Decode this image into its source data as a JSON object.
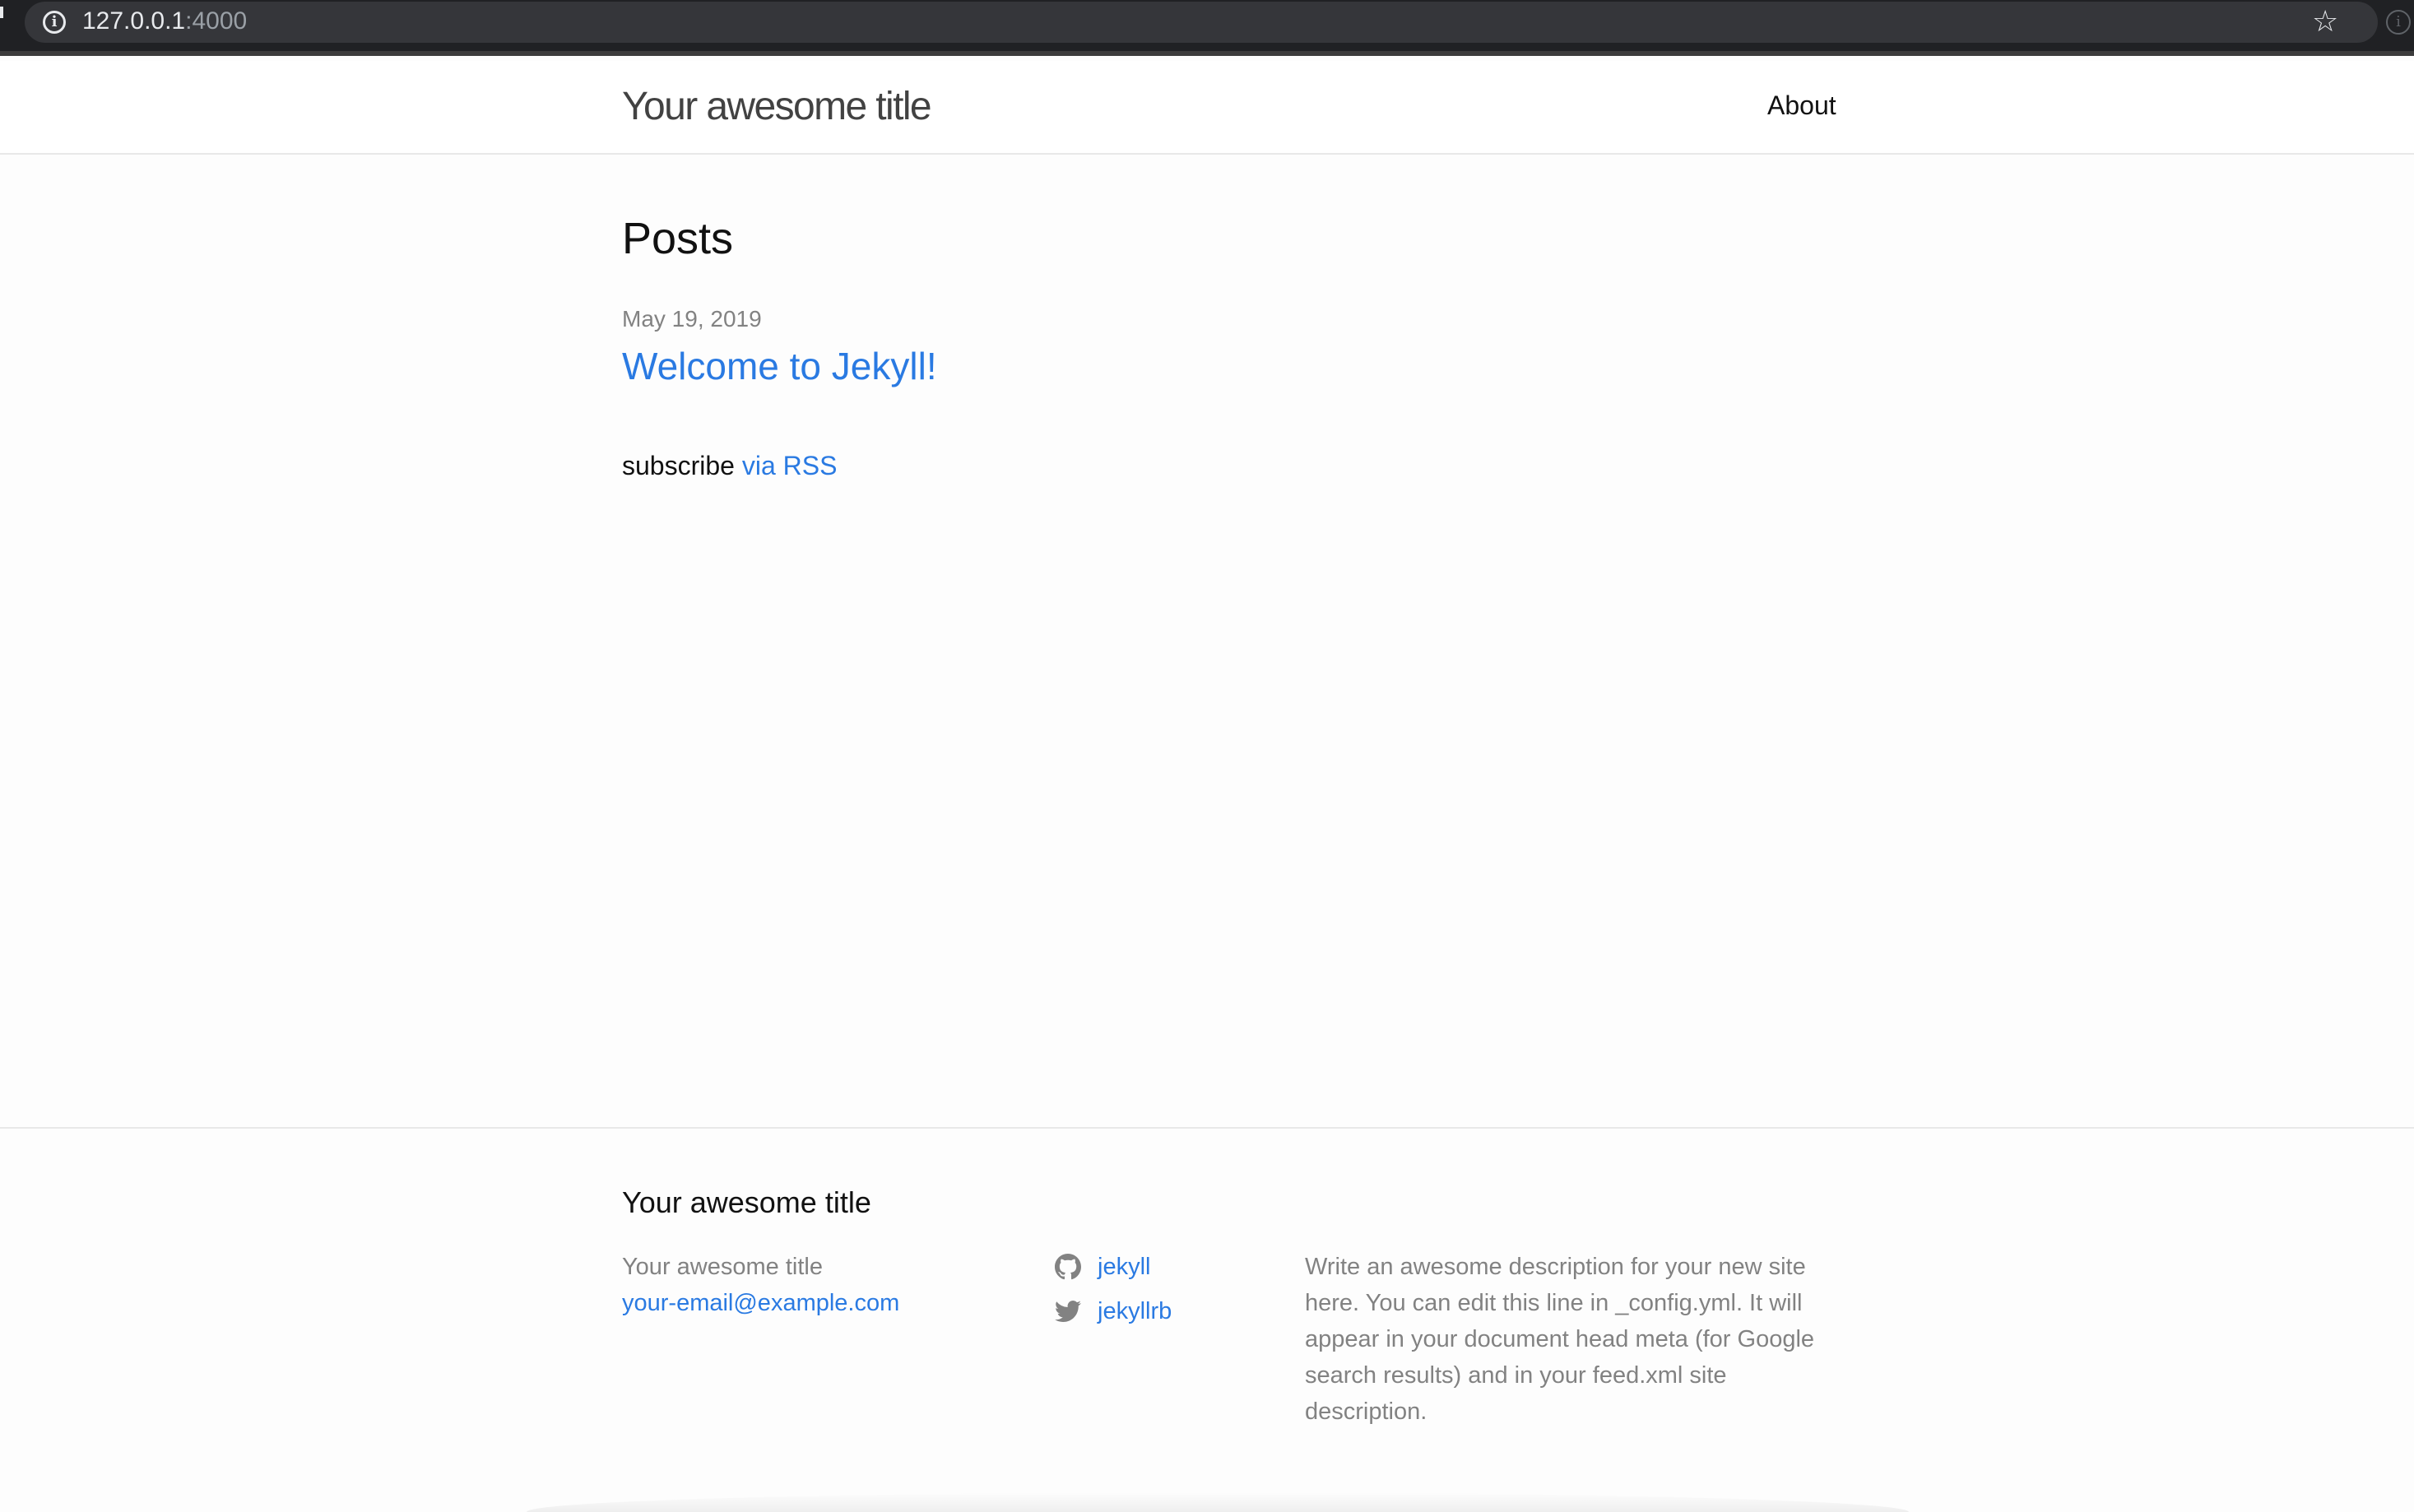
{
  "browser": {
    "url_host": "127.0.0.1",
    "url_port": ":4000"
  },
  "header": {
    "site_title": "Your awesome title",
    "nav": [
      {
        "label": "About"
      }
    ]
  },
  "main": {
    "heading": "Posts",
    "posts": [
      {
        "date": "May 19, 2019",
        "title": "Welcome to Jekyll!"
      }
    ],
    "rss": {
      "prefix": "subscribe",
      "link_label": "via RSS"
    }
  },
  "footer": {
    "heading": "Your awesome title",
    "name": "Your awesome title",
    "email": "your-email@example.com",
    "social": [
      {
        "icon": "github-icon",
        "label": "jekyll"
      },
      {
        "icon": "twitter-icon",
        "label": "jekyllrb"
      }
    ],
    "description": "Write an awesome description for your new site here. You can edit this line in _config.yml. It will appear in your document head meta (for Google search results) and in your feed.xml site description."
  },
  "colors": {
    "link": "#2a7ae2",
    "muted_text": "#828282",
    "title_text": "#424242",
    "browser_bar": "#202124"
  }
}
